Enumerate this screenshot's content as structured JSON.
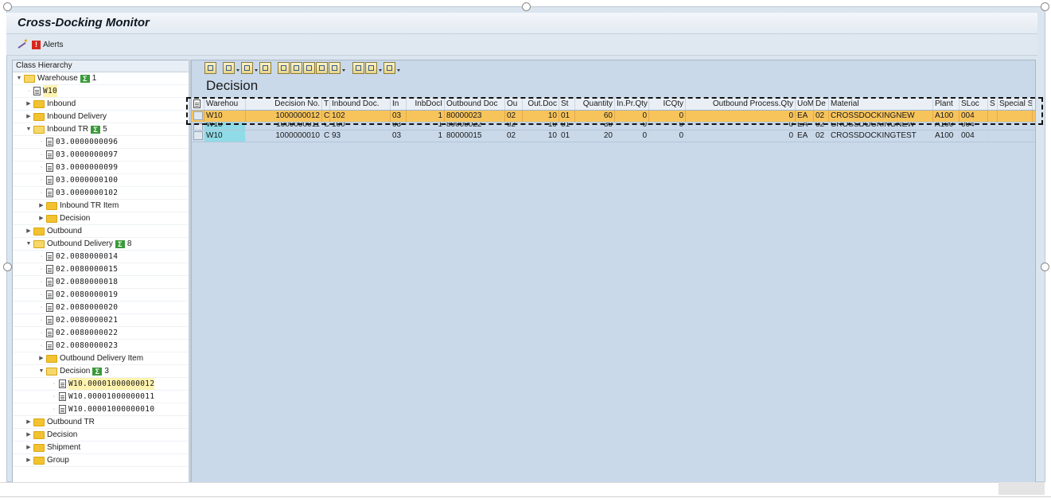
{
  "app": {
    "title": "Cross-Docking Monitor"
  },
  "toolbar": {
    "alerts_label": "Alerts"
  },
  "tree": {
    "header": "Class Hierarchy",
    "nodes": [
      {
        "label": "Warehouse",
        "count": "1",
        "level": 0,
        "kind": "folder",
        "open": true
      },
      {
        "label": "W10",
        "level": 1,
        "kind": "doc",
        "mono": true,
        "selected": true
      },
      {
        "label": "Inbound",
        "level": 1,
        "kind": "folder",
        "open": false
      },
      {
        "label": "Inbound Delivery",
        "level": 1,
        "kind": "folder",
        "open": false
      },
      {
        "label": "Inbound TR",
        "count": "5",
        "level": 1,
        "kind": "folder",
        "open": true
      },
      {
        "label": "03.0000000096",
        "level": 2,
        "kind": "doc",
        "mono": true
      },
      {
        "label": "03.0000000097",
        "level": 2,
        "kind": "doc",
        "mono": true
      },
      {
        "label": "03.0000000099",
        "level": 2,
        "kind": "doc",
        "mono": true
      },
      {
        "label": "03.0000000100",
        "level": 2,
        "kind": "doc",
        "mono": true
      },
      {
        "label": "03.0000000102",
        "level": 2,
        "kind": "doc",
        "mono": true
      },
      {
        "label": "Inbound TR Item",
        "level": 2,
        "kind": "folder",
        "open": false
      },
      {
        "label": "Decision",
        "level": 2,
        "kind": "folder",
        "open": false
      },
      {
        "label": "Outbound",
        "level": 1,
        "kind": "folder",
        "open": false
      },
      {
        "label": "Outbound Delivery",
        "count": "8",
        "level": 1,
        "kind": "folder",
        "open": true
      },
      {
        "label": "02.0080000014",
        "level": 2,
        "kind": "doc",
        "mono": true
      },
      {
        "label": "02.0080000015",
        "level": 2,
        "kind": "doc",
        "mono": true
      },
      {
        "label": "02.0080000018",
        "level": 2,
        "kind": "doc",
        "mono": true
      },
      {
        "label": "02.0080000019",
        "level": 2,
        "kind": "doc",
        "mono": true
      },
      {
        "label": "02.0080000020",
        "level": 2,
        "kind": "doc",
        "mono": true
      },
      {
        "label": "02.0080000021",
        "level": 2,
        "kind": "doc",
        "mono": true
      },
      {
        "label": "02.0080000022",
        "level": 2,
        "kind": "doc",
        "mono": true
      },
      {
        "label": "02.0080000023",
        "level": 2,
        "kind": "doc",
        "mono": true
      },
      {
        "label": "Outbound Delivery Item",
        "level": 2,
        "kind": "folder",
        "open": false
      },
      {
        "label": "Decision",
        "count": "3",
        "level": 2,
        "kind": "folder",
        "open": true
      },
      {
        "label": "W10.00001000000012",
        "level": 3,
        "kind": "doc",
        "mono": true,
        "selected": true
      },
      {
        "label": "W10.00001000000011",
        "level": 3,
        "kind": "doc",
        "mono": true
      },
      {
        "label": "W10.00001000000010",
        "level": 3,
        "kind": "doc",
        "mono": true
      },
      {
        "label": "Outbound TR",
        "level": 1,
        "kind": "folder",
        "open": false
      },
      {
        "label": "Decision",
        "level": 1,
        "kind": "folder",
        "open": false
      },
      {
        "label": "Shipment",
        "level": 1,
        "kind": "folder",
        "open": false
      },
      {
        "label": "Group",
        "level": 1,
        "kind": "folder",
        "open": false
      }
    ]
  },
  "grid": {
    "title": "Decision",
    "columns": [
      {
        "label": "Warehou",
        "align": "l"
      },
      {
        "label": "Decision No.",
        "align": "r"
      },
      {
        "label": "T",
        "align": "l"
      },
      {
        "label": "Inbound Doc.",
        "align": "l"
      },
      {
        "label": "In",
        "align": "l"
      },
      {
        "label": "InbDocI",
        "align": "r"
      },
      {
        "label": "Outbound Doc",
        "align": "l"
      },
      {
        "label": "Ou",
        "align": "l"
      },
      {
        "label": "Out.Doc",
        "align": "r"
      },
      {
        "label": "St",
        "align": "l"
      },
      {
        "label": "Quantity",
        "align": "r"
      },
      {
        "label": "In.Pr.Qty",
        "align": "r"
      },
      {
        "label": "ICQty",
        "align": "r"
      },
      {
        "label": "Outbound Process.Qty",
        "align": "r"
      },
      {
        "label": "UoM",
        "align": "l"
      },
      {
        "label": "De",
        "align": "l"
      },
      {
        "label": "Material",
        "align": "l"
      },
      {
        "label": "Plant",
        "align": "l"
      },
      {
        "label": "SLoc",
        "align": "l"
      },
      {
        "label": "S",
        "align": "l"
      },
      {
        "label": "Special S",
        "align": "l"
      }
    ],
    "rows": [
      {
        "cells": [
          "W10",
          "1000000012",
          "C",
          "102",
          "03",
          "1",
          "80000023",
          "02",
          "10",
          "01",
          "60",
          "0",
          "0",
          "0",
          "EA",
          "02",
          "CROSSDOCKINGNEW",
          "A100",
          "004",
          "",
          ""
        ],
        "selected": true
      },
      {
        "cells": [
          "W10",
          "1000000011",
          "C",
          "100",
          "03",
          "1",
          "80000022",
          "02",
          "10",
          "01",
          "30",
          "0",
          "0",
          "0",
          "EA",
          "02",
          "CROSSDOCKINGNEW",
          "A100",
          "004",
          "",
          ""
        ],
        "cut": true
      },
      {
        "cells": [
          "W10",
          "1000000010",
          "C",
          "93",
          "03",
          "1",
          "80000015",
          "02",
          "10",
          "01",
          "20",
          "0",
          "0",
          "0",
          "EA",
          "02",
          "CROSSDOCKINGTEST",
          "A100",
          "004",
          "",
          ""
        ]
      }
    ]
  }
}
